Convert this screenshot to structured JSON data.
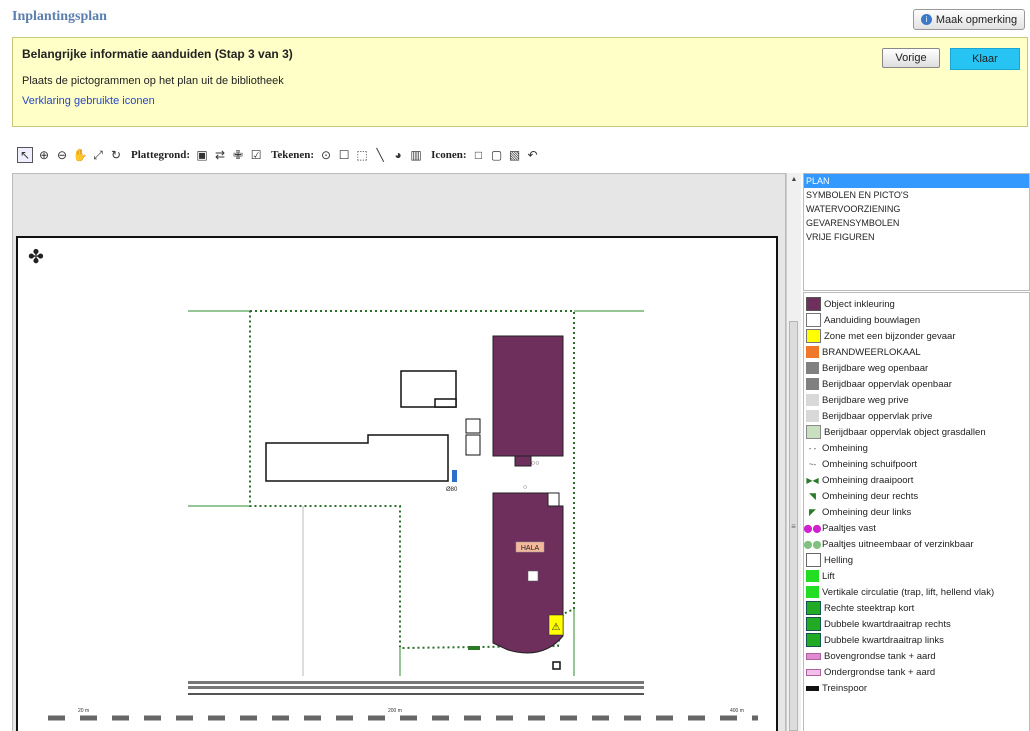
{
  "header": {
    "title": "Inplantingsplan",
    "remark_button": "Maak opmerking"
  },
  "info": {
    "heading": "Belangrijke informatie aanduiden (Stap 3 van 3)",
    "line1": "Plaats de pictogrammen op het plan uit de bibliotheek",
    "link": "Verklaring gebruikte iconen",
    "prev_button": "Vorige",
    "done_button": "Klaar"
  },
  "toolbar": {
    "plattegrond_label": "Plattegrond:",
    "tekenen_label": "Tekenen:",
    "iconen_label": "Iconen:"
  },
  "map": {
    "building_label": "HALA",
    "pipe_label": "Ø80",
    "scale_labels": [
      "20 m",
      "200 m",
      "400 m"
    ]
  },
  "categories": [
    "PLAN",
    "SYMBOLEN EN PICTO'S",
    "WATERVOORZIENING",
    "GEVARENSYMBOLEN",
    "VRIJE FIGUREN"
  ],
  "legend": [
    {
      "label": "Object inkleuring",
      "color": "#6e2f5d"
    },
    {
      "label": "Aanduiding bouwlagen",
      "color": "#ffffff"
    },
    {
      "label": "Zone met een bijzonder gevaar",
      "color": "#ffff00"
    },
    {
      "label": "BRANDWEERLOKAAL",
      "color": "#f07828"
    },
    {
      "label": "Berijdbare weg openbaar",
      "color": "#808080"
    },
    {
      "label": "Berijdbaar oppervlak openbaar",
      "color": "#808080"
    },
    {
      "label": "Berijdbare weg prive",
      "color": "#d8d8d8"
    },
    {
      "label": "Berijdbaar oppervlak prive",
      "color": "#d8d8d8"
    },
    {
      "label": "Berijdbaar oppervlak object grasdallen",
      "color": "#c8e0c0"
    },
    {
      "label": "Omheining",
      "color": "#444444"
    },
    {
      "label": "Omheining schuifpoort",
      "color": "#444444"
    },
    {
      "label": "Omheining draaipoort",
      "color": "#2a7a2a"
    },
    {
      "label": "Omheining deur rechts",
      "color": "#2a7a2a"
    },
    {
      "label": "Omheining deur links",
      "color": "#2a7a2a"
    },
    {
      "label": "Paaltjes vast",
      "color": "#d020d0"
    },
    {
      "label": "Paaltjes uitneembaar of verzinkbaar",
      "color": "#80c080"
    },
    {
      "label": "Helling",
      "color": "#888888"
    },
    {
      "label": "Lift",
      "color": "#22dd22"
    },
    {
      "label": "Vertikale circulatie (trap, lift, hellend vlak)",
      "color": "#22dd22"
    },
    {
      "label": "Rechte steektrap kort",
      "color": "#22aa22"
    },
    {
      "label": "Dubbele kwartdraaitrap rechts",
      "color": "#22aa22"
    },
    {
      "label": "Dubbele kwartdraaitrap links",
      "color": "#22aa22"
    },
    {
      "label": "Bovengrondse tank + aard",
      "color": "#e08ad0"
    },
    {
      "label": "Ondergrondse tank + aard",
      "color": "#e08ad0"
    },
    {
      "label": "Treinspoor",
      "color": "#111111"
    }
  ]
}
